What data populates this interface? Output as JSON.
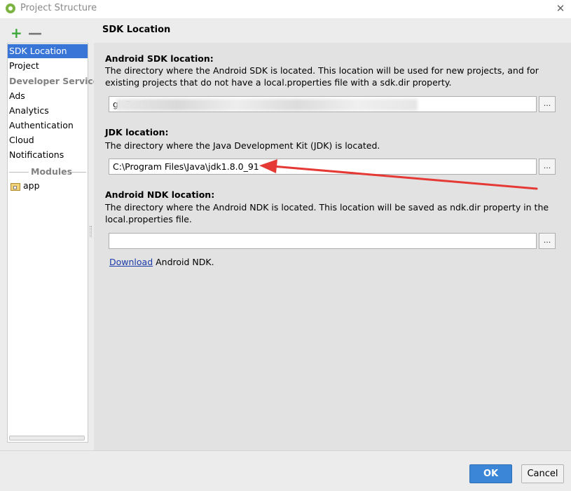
{
  "window": {
    "title": "Project Structure",
    "app_icon": "android-studio-icon",
    "close_icon": "✕"
  },
  "toolbar": {
    "add_label": "+",
    "remove_label": "—"
  },
  "sidebar": {
    "items": [
      {
        "label": "SDK Location",
        "selected": true
      },
      {
        "label": "Project"
      }
    ],
    "developer_services_header": "Developer Services",
    "services": [
      {
        "label": "Ads"
      },
      {
        "label": "Analytics"
      },
      {
        "label": "Authentication"
      },
      {
        "label": "Cloud"
      },
      {
        "label": "Notifications"
      }
    ],
    "modules_header": "Modules",
    "modules": [
      {
        "label": "app",
        "icon": "module-folder-icon"
      }
    ]
  },
  "panel": {
    "title": "SDK Location",
    "android_sdk": {
      "title": "Android SDK location:",
      "description": "The directory where the Android SDK is located. This location will be used for new projects, and for existing projects that do not have a local.properties file with a sdk.dir property.",
      "value": "gicParticle",
      "browse_label": "..."
    },
    "jdk": {
      "title": "JDK location:",
      "description": "The directory where the Java Development Kit (JDK) is located.",
      "value": "C:\\Program Files\\Java\\jdk1.8.0_91",
      "browse_label": "..."
    },
    "ndk": {
      "title": "Android NDK location:",
      "description": "The directory where the Android NDK is located. This location will be saved as ndk.dir property in the local.properties file.",
      "value": "",
      "browse_label": "...",
      "download_link": "Download",
      "download_suffix": " Android NDK."
    }
  },
  "footer": {
    "ok_label": "OK",
    "cancel_label": "Cancel"
  },
  "colors": {
    "selection": "#3875d7",
    "ok_button": "#3b86d6",
    "annotation_arrow": "#e53935",
    "add_icon": "#3ca83a"
  }
}
